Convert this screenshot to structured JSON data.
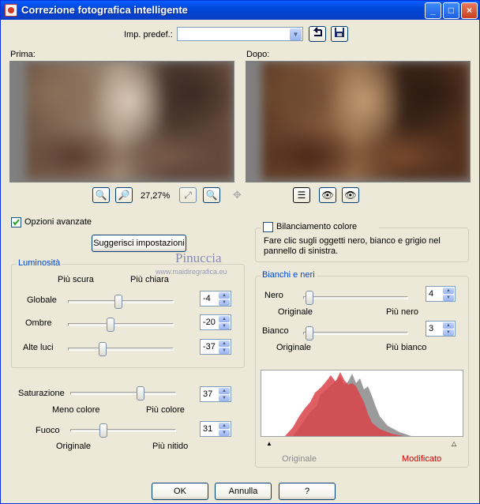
{
  "window": {
    "title": "Correzione fotografica intelligente"
  },
  "preset": {
    "label": "Imp. predef.:",
    "value": ""
  },
  "preview": {
    "before_label": "Prima:",
    "after_label": "Dopo:",
    "zoom": "27,27%"
  },
  "advanced": {
    "label": "Opzioni avanzate",
    "checked": true,
    "suggest_button": "Suggerisci impostazioni"
  },
  "watermark": {
    "name": "Pinuccia",
    "url": "www.maidiregrafica.eu"
  },
  "brightness": {
    "title": "Luminosità",
    "low": "Più scura",
    "high": "Più chiara",
    "rows": [
      {
        "label": "Globale",
        "value": "-4",
        "fraction": 0.45
      },
      {
        "label": "Ombre",
        "value": "-20",
        "fraction": 0.38
      },
      {
        "label": "Alte luci",
        "value": "-37",
        "fraction": 0.31
      }
    ]
  },
  "saturation": {
    "label": "Saturazione",
    "value": "37",
    "fraction": 0.68,
    "low": "Meno colore",
    "high": "Più colore"
  },
  "focus": {
    "label": "Fuoco",
    "value": "31",
    "fraction": 0.31,
    "low": "Originale",
    "high": "Più nitido"
  },
  "color_balance": {
    "label": "Bilanciamento colore",
    "checked": false,
    "hint": "Fare clic sugli oggetti nero, bianco e grigio nel pannello di sinistra."
  },
  "blacks_whites": {
    "title": "Bianchi e neri",
    "black": {
      "label": "Nero",
      "value": "4",
      "fraction": 0.02,
      "low": "Originale",
      "high": "Più nero"
    },
    "white": {
      "label": "Bianco",
      "value": "3",
      "fraction": 0.02,
      "low": "Originale",
      "high": "Più bianco"
    }
  },
  "histogram": {
    "original_label": "Originale",
    "modified_label": "Modificato",
    "original_color": "#8a8a8a",
    "modified_color": "#d40000"
  },
  "buttons": {
    "ok": "OK",
    "cancel": "Annulla",
    "help": "?"
  }
}
